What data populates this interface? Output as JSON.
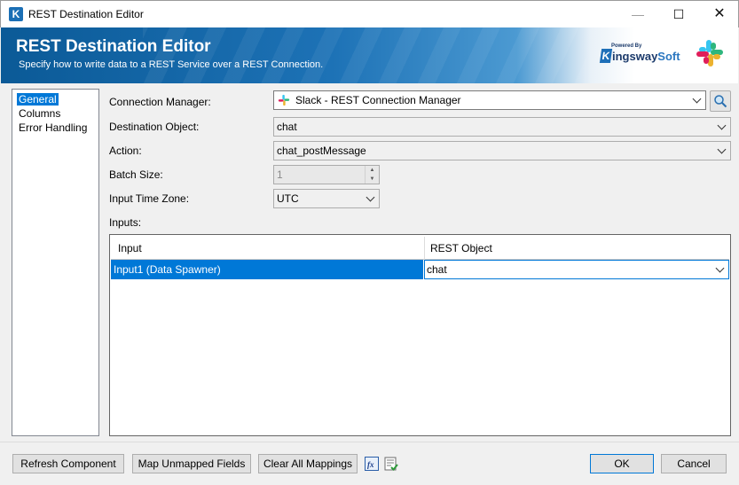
{
  "window": {
    "title": "REST Destination Editor",
    "minimize": "—",
    "maximize": "☐",
    "close": "✕"
  },
  "banner": {
    "title": "REST Destination Editor",
    "subtitle": "Specify how to write data to a REST Service over a REST Connection.",
    "logo_powered_by": "Powered By",
    "logo_name_a": "ingsway",
    "logo_name_b": "Soft",
    "logo_letter": "K"
  },
  "nav": {
    "items": [
      {
        "label": "General",
        "selected": true
      },
      {
        "label": "Columns"
      },
      {
        "label": "Error Handling"
      }
    ]
  },
  "form": {
    "connection_manager": {
      "label": "Connection Manager:",
      "value": "Slack - REST Connection Manager"
    },
    "destination_object": {
      "label": "Destination Object:",
      "value": "chat"
    },
    "action": {
      "label": "Action:",
      "value": "chat_postMessage"
    },
    "batch_size": {
      "label": "Batch Size:",
      "value": "1"
    },
    "input_time_zone": {
      "label": "Input Time Zone:",
      "value": "UTC"
    },
    "inputs_label": "Inputs:"
  },
  "grid": {
    "columns": [
      "Input",
      "REST Object"
    ],
    "rows": [
      {
        "input": "Input1 (Data Spawner)",
        "rest_object": "chat"
      }
    ]
  },
  "buttons": {
    "refresh": "Refresh Component",
    "map_unmapped": "Map Unmapped Fields",
    "clear_all": "Clear All Mappings",
    "ok": "OK",
    "cancel": "Cancel"
  },
  "colors": {
    "accent": "#0078d7",
    "banner_blue": "#1d72b6"
  }
}
